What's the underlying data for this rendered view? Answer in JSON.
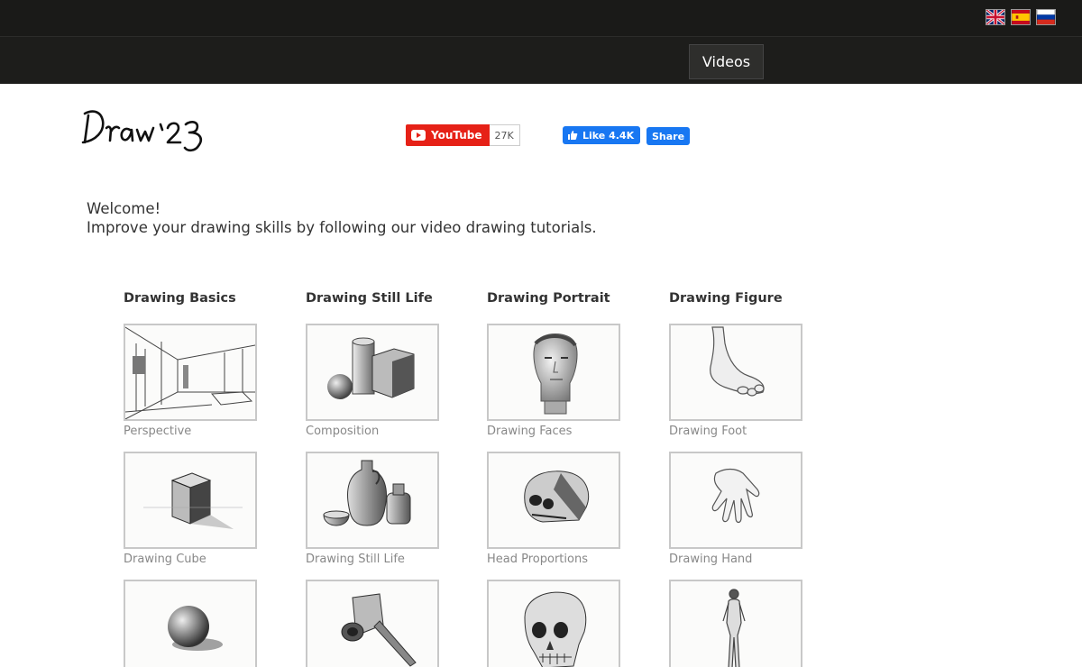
{
  "header": {
    "languages": [
      {
        "name": "English",
        "icon": "uk-flag-icon"
      },
      {
        "name": "Español",
        "icon": "spain-flag-icon"
      },
      {
        "name": "Русский",
        "icon": "russia-flag-icon"
      }
    ],
    "nav": {
      "videos_label": "Videos"
    }
  },
  "brand": {
    "logo_text": "Draw 23"
  },
  "social": {
    "youtube_label": "YouTube",
    "youtube_count": "27K",
    "fb_like_label": "Like 4.4K",
    "fb_share_label": "Share",
    "colors": {
      "youtube": "#e62117",
      "facebook": "#1877f2"
    }
  },
  "intro": {
    "line1": "Welcome!",
    "line2": "Improve your drawing skills by following our video drawing tutorials."
  },
  "categories": [
    {
      "title": "Drawing Basics",
      "items": [
        {
          "label": "Perspective",
          "image": "perspective-sketch"
        },
        {
          "label": "Drawing Cube",
          "image": "cube-sketch"
        },
        {
          "label": "",
          "image": "sphere-sketch"
        }
      ]
    },
    {
      "title": "Drawing Still Life",
      "items": [
        {
          "label": "Composition",
          "image": "composition-sketch"
        },
        {
          "label": "Drawing Still Life",
          "image": "still-life-sketch"
        },
        {
          "label": "",
          "image": "funnel-sketch"
        }
      ]
    },
    {
      "title": "Drawing Portrait",
      "items": [
        {
          "label": "Drawing Faces",
          "image": "face-bust-sketch"
        },
        {
          "label": "Head Proportions",
          "image": "head-proportions-sketch"
        },
        {
          "label": "",
          "image": "skull-sketch"
        }
      ]
    },
    {
      "title": "Drawing Figure",
      "items": [
        {
          "label": "Drawing Foot",
          "image": "foot-sketch"
        },
        {
          "label": "Drawing Hand",
          "image": "hand-sketch"
        },
        {
          "label": "",
          "image": "figure-sketch"
        }
      ]
    }
  ]
}
